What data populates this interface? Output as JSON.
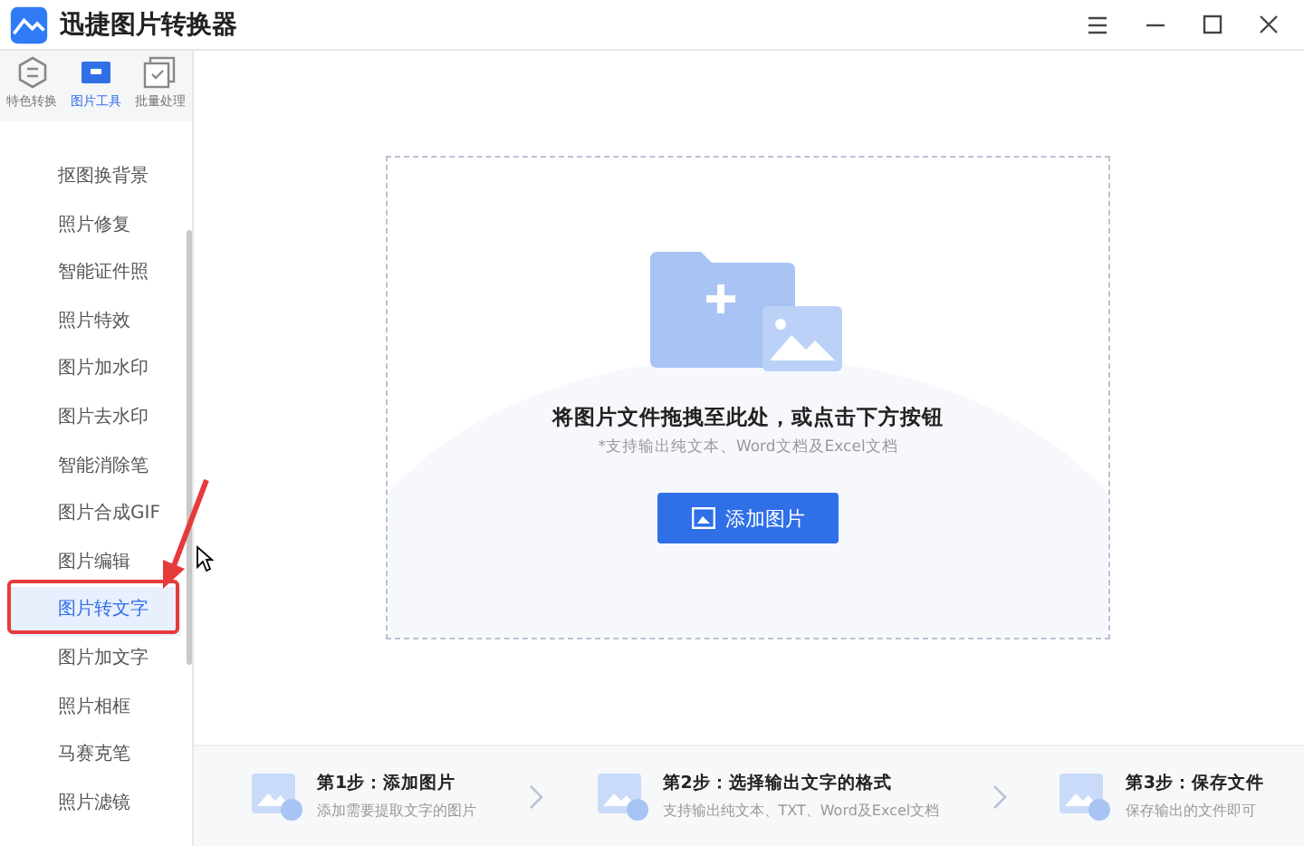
{
  "window": {
    "title": "迅捷图片转换器"
  },
  "tabs": [
    {
      "label": "特色转换",
      "selected": false
    },
    {
      "label": "图片工具",
      "selected": true
    },
    {
      "label": "批量处理",
      "selected": false
    }
  ],
  "menu": [
    {
      "label": "抠图换背景",
      "selected": false
    },
    {
      "label": "照片修复",
      "selected": false
    },
    {
      "label": "智能证件照",
      "selected": false
    },
    {
      "label": "照片特效",
      "selected": false
    },
    {
      "label": "图片加水印",
      "selected": false
    },
    {
      "label": "图片去水印",
      "selected": false
    },
    {
      "label": "智能消除笔",
      "selected": false
    },
    {
      "label": "图片合成GIF",
      "selected": false
    },
    {
      "label": "图片编辑",
      "selected": false
    },
    {
      "label": "图片转文字",
      "selected": true
    },
    {
      "label": "图片加文字",
      "selected": false
    },
    {
      "label": "照片相框",
      "selected": false
    },
    {
      "label": "马赛克笔",
      "selected": false
    },
    {
      "label": "照片滤镜",
      "selected": false
    }
  ],
  "dropzone": {
    "title": "将图片文件拖拽至此处，或点击下方按钮",
    "hint": "*支持输出纯文本、Word文档及Excel文档",
    "button": "添加图片"
  },
  "steps": [
    {
      "title": "第1步：添加图片",
      "desc": "添加需要提取文字的图片"
    },
    {
      "title": "第2步：选择输出文字的格式",
      "desc": "支持输出纯文本、TXT、Word及Excel文档"
    },
    {
      "title": "第3步：保存文件",
      "desc": "保存输出的文件即可"
    }
  ]
}
